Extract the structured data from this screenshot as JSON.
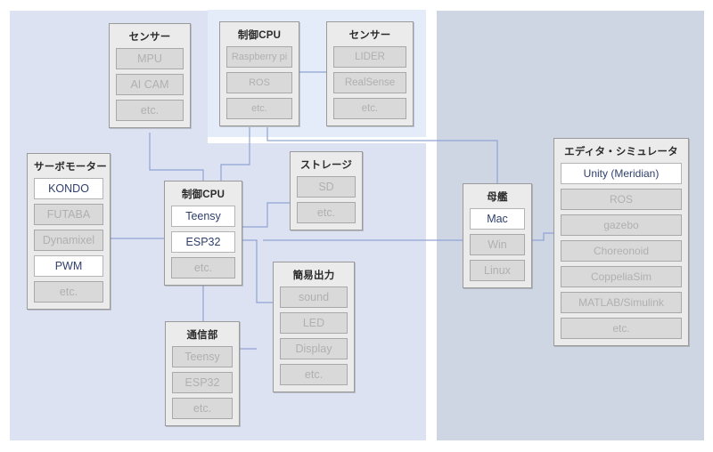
{
  "diagram": {
    "title": "Meridian system architecture block diagram",
    "panels": [
      {
        "name": "robot-side-panel",
        "color": "#dce2f1"
      },
      {
        "name": "pc-side-panel",
        "color": "#cfd6e3"
      },
      {
        "name": "highlight-panel",
        "color": "#e4ecfa"
      }
    ],
    "accent_line_color": "#8fa4d4",
    "active_item_text_color": "#2f3f6b",
    "inactive_item_text_color": "#b0b0b0"
  },
  "groups": {
    "sensor_top": {
      "title": "センサー",
      "items": [
        {
          "label": "MPU",
          "active": false
        },
        {
          "label": "AI CAM",
          "active": false
        },
        {
          "label": "etc.",
          "active": false
        }
      ]
    },
    "cpu_rpi": {
      "title": "制御CPU",
      "items": [
        {
          "label": "Raspberry pi",
          "active": false
        },
        {
          "label": "ROS",
          "active": false
        },
        {
          "label": "etc.",
          "active": false
        }
      ]
    },
    "sensor_lidar": {
      "title": "センサー",
      "items": [
        {
          "label": "LIDER",
          "active": false
        },
        {
          "label": "RealSense",
          "active": false
        },
        {
          "label": "etc.",
          "active": false
        }
      ]
    },
    "servo": {
      "title": "サーボモーター",
      "items": [
        {
          "label": "KONDO",
          "active": true
        },
        {
          "label": "FUTABA",
          "active": false
        },
        {
          "label": "Dynamixel",
          "active": false
        },
        {
          "label": "PWM",
          "active": true
        },
        {
          "label": "etc.",
          "active": false
        }
      ]
    },
    "cpu_teensy": {
      "title": "制御CPU",
      "items": [
        {
          "label": "Teensy",
          "active": true
        },
        {
          "label": "ESP32",
          "active": true
        },
        {
          "label": "etc.",
          "active": false
        }
      ]
    },
    "storage": {
      "title": "ストレージ",
      "items": [
        {
          "label": "SD",
          "active": false
        },
        {
          "label": "etc.",
          "active": false
        }
      ]
    },
    "output": {
      "title": "簡易出力",
      "items": [
        {
          "label": "sound",
          "active": false
        },
        {
          "label": "LED",
          "active": false
        },
        {
          "label": "Display",
          "active": false
        },
        {
          "label": "etc.",
          "active": false
        }
      ]
    },
    "comm": {
      "title": "通信部",
      "items": [
        {
          "label": "Teensy",
          "active": false
        },
        {
          "label": "ESP32",
          "active": false
        },
        {
          "label": "etc.",
          "active": false
        }
      ]
    },
    "mother": {
      "title": "母艦",
      "items": [
        {
          "label": "Mac",
          "active": true
        },
        {
          "label": "Win",
          "active": false
        },
        {
          "label": "Linux",
          "active": false
        }
      ]
    },
    "editor": {
      "title": "エディタ・シミュレータ",
      "items": [
        {
          "label": "Unity (Meridian)",
          "active": true
        },
        {
          "label": "ROS",
          "active": false
        },
        {
          "label": "gazebo",
          "active": false
        },
        {
          "label": "Choreonoid",
          "active": false
        },
        {
          "label": "CoppeliaSim",
          "active": false
        },
        {
          "label": "MATLAB/Simulink",
          "active": false
        },
        {
          "label": "etc.",
          "active": false
        }
      ]
    }
  }
}
